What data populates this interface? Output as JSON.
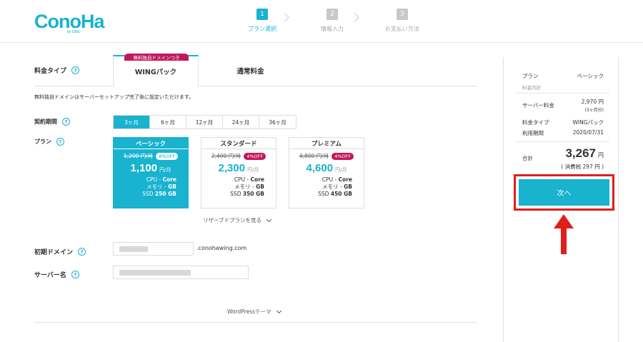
{
  "brand": {
    "logo": "ConoHa",
    "sub": "by GMO"
  },
  "steps": [
    {
      "num": "1",
      "label": "プラン選択"
    },
    {
      "num": "2",
      "label": "情報入力"
    },
    {
      "num": "3",
      "label": "お支払い方法"
    }
  ],
  "form": {
    "plan_type_label": "料金タイプ",
    "tabs": {
      "wing": "WINGパック",
      "wing_badge": "無料独自ドメインつき",
      "normal": "通常料金"
    },
    "note": "無料独自ドメインはサーバーセットアップ完了後に設定いただけます。",
    "period_label": "契約期間",
    "periods": [
      "3ヶ月",
      "6ヶ月",
      "12ヶ月",
      "24ヶ月",
      "36ヶ月"
    ],
    "plan_label": "プラン",
    "plans": [
      {
        "name": "ベーシック",
        "old": "1,200 円/月",
        "off": "8%OFF",
        "price": "1,100",
        "unit": "円/月",
        "cpu": "CPU - ",
        "cpu_v": "Core",
        "mem": "メモリ - ",
        "mem_v": "GB",
        "ssd": "SSD ",
        "ssd_v": "250 GB"
      },
      {
        "name": "スタンダード",
        "old": "2,400 円/月",
        "off": "4%OFF",
        "price": "2,300",
        "unit": "円/月",
        "cpu": "CPU - ",
        "cpu_v": "Core",
        "mem": "メモリ - ",
        "mem_v": "GB",
        "ssd": "SSD ",
        "ssd_v": "350 GB"
      },
      {
        "name": "プレミアム",
        "old": "4,800 円/月",
        "off": "4%OFF",
        "price": "4,600",
        "unit": "円/月",
        "cpu": "CPU - ",
        "cpu_v": "Core",
        "mem": "メモリ - ",
        "mem_v": "GB",
        "ssd": "SSD ",
        "ssd_v": "450 GB"
      }
    ],
    "reserve_link": "リザーブドプランを見る",
    "domain_label": "初期ドメイン",
    "domain_suffix": ".conohawing.com",
    "server_label": "サーバー名",
    "wp_link": "WordPressテーマ"
  },
  "summary": {
    "plan_label": "プラン",
    "plan_value": "ベーシック",
    "detail_label": "料金内訳",
    "server_fee_label": "サーバー料金",
    "server_fee_value": "2,970 円",
    "server_fee_note": "(3ヶ月分)",
    "type_label": "料金タイプ",
    "type_value": "WINGパック",
    "period_label": "利用期間",
    "period_value": "2020/07/31",
    "total_label": "合計",
    "total_value": "3,267",
    "total_unit": "円",
    "tax_note": "( 消費税 297 円 )",
    "next_button": "次へ"
  },
  "colors": {
    "accent": "#19b2cf",
    "badge": "#c2185b",
    "highlight": "#e01e1e"
  }
}
